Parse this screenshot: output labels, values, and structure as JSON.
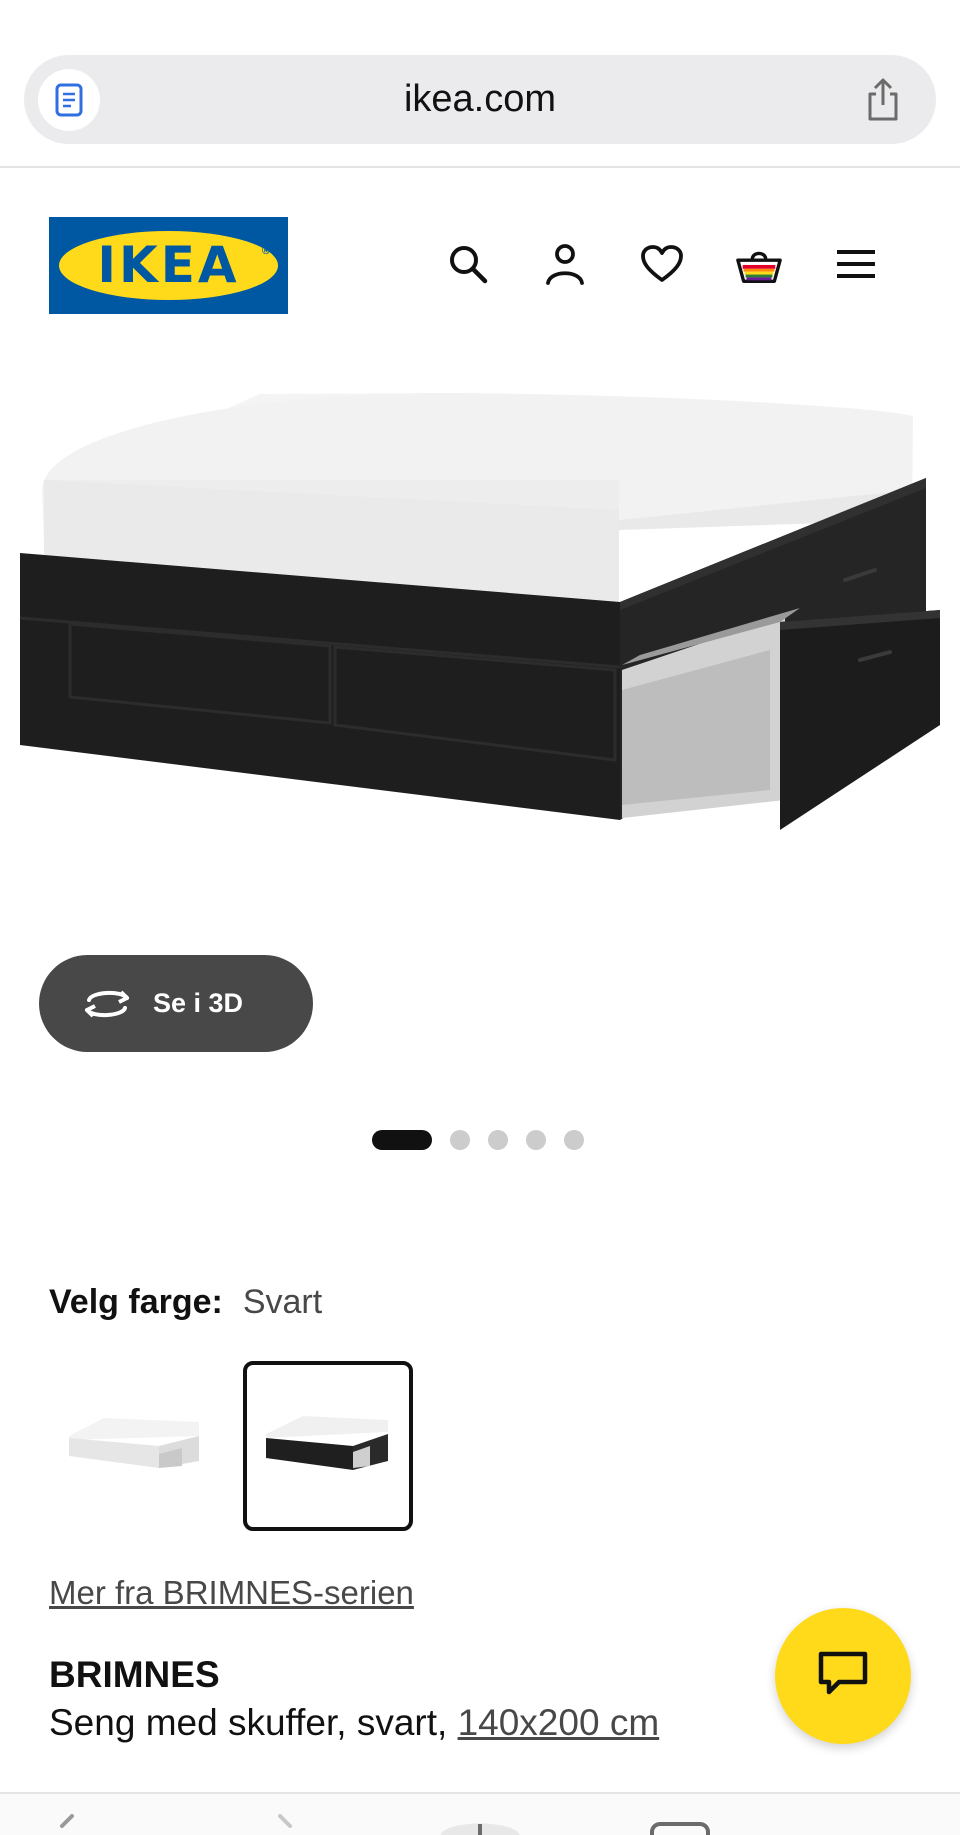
{
  "browser": {
    "url": "ikea.com"
  },
  "header": {
    "logo_text": "IKEA",
    "logo_reg": "®"
  },
  "gallery": {
    "view_3d_label": "Se i 3D",
    "total_images": 5,
    "active_image": 1
  },
  "color_picker": {
    "label": "Velg farge:",
    "selected_value": "Svart",
    "options": [
      "Hvit",
      "Svart"
    ]
  },
  "product": {
    "series_link": "Mer fra BRIMNES-serien",
    "name": "BRIMNES",
    "description": "Seng med skuffer, svart,",
    "size_link": "140x200 cm"
  },
  "colors": {
    "ikea_blue": "#0058a3",
    "ikea_yellow": "#ffda1a",
    "button_dark": "#484848"
  },
  "icons": [
    "reader-icon",
    "share-icon",
    "search-icon",
    "user-icon",
    "heart-icon",
    "basket-icon",
    "menu-icon",
    "rotate-3d-icon",
    "chat-icon"
  ]
}
